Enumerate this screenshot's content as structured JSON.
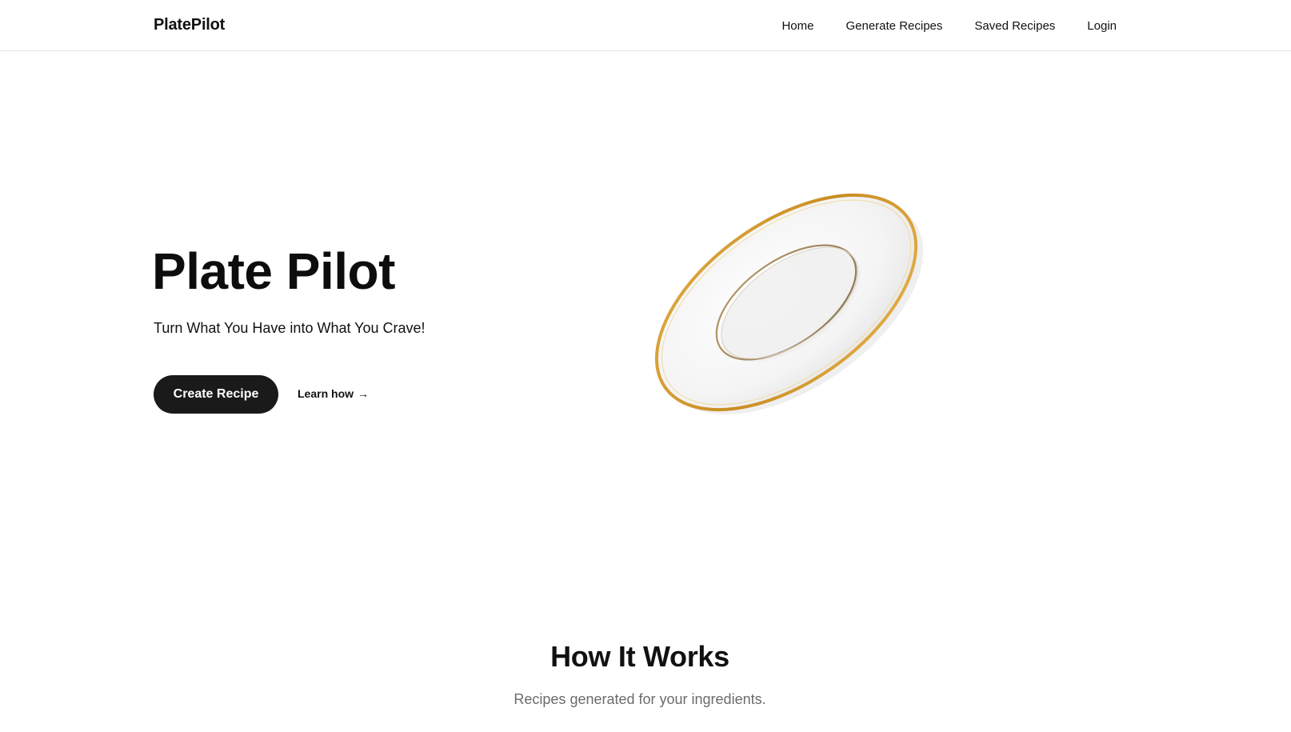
{
  "navbar": {
    "brand": "PlatePilot",
    "links": [
      {
        "label": "Home"
      },
      {
        "label": "Generate Recipes"
      },
      {
        "label": "Saved Recipes"
      },
      {
        "label": "Login"
      }
    ]
  },
  "hero": {
    "title": "Plate Pilot",
    "subtitle": "Turn What You Have into What You Crave!",
    "cta_label": "Create Recipe",
    "learn_label": "Learn how",
    "learn_icon": "arrow-right-icon",
    "image": "plate-image"
  },
  "how_it_works": {
    "title": "How It Works",
    "subtitle": "Recipes generated for your ingredients."
  },
  "colors": {
    "cta_background": "#1a1a1a",
    "plate_rim": "#d9a233",
    "subtitle_gray": "#6b6b6b"
  }
}
